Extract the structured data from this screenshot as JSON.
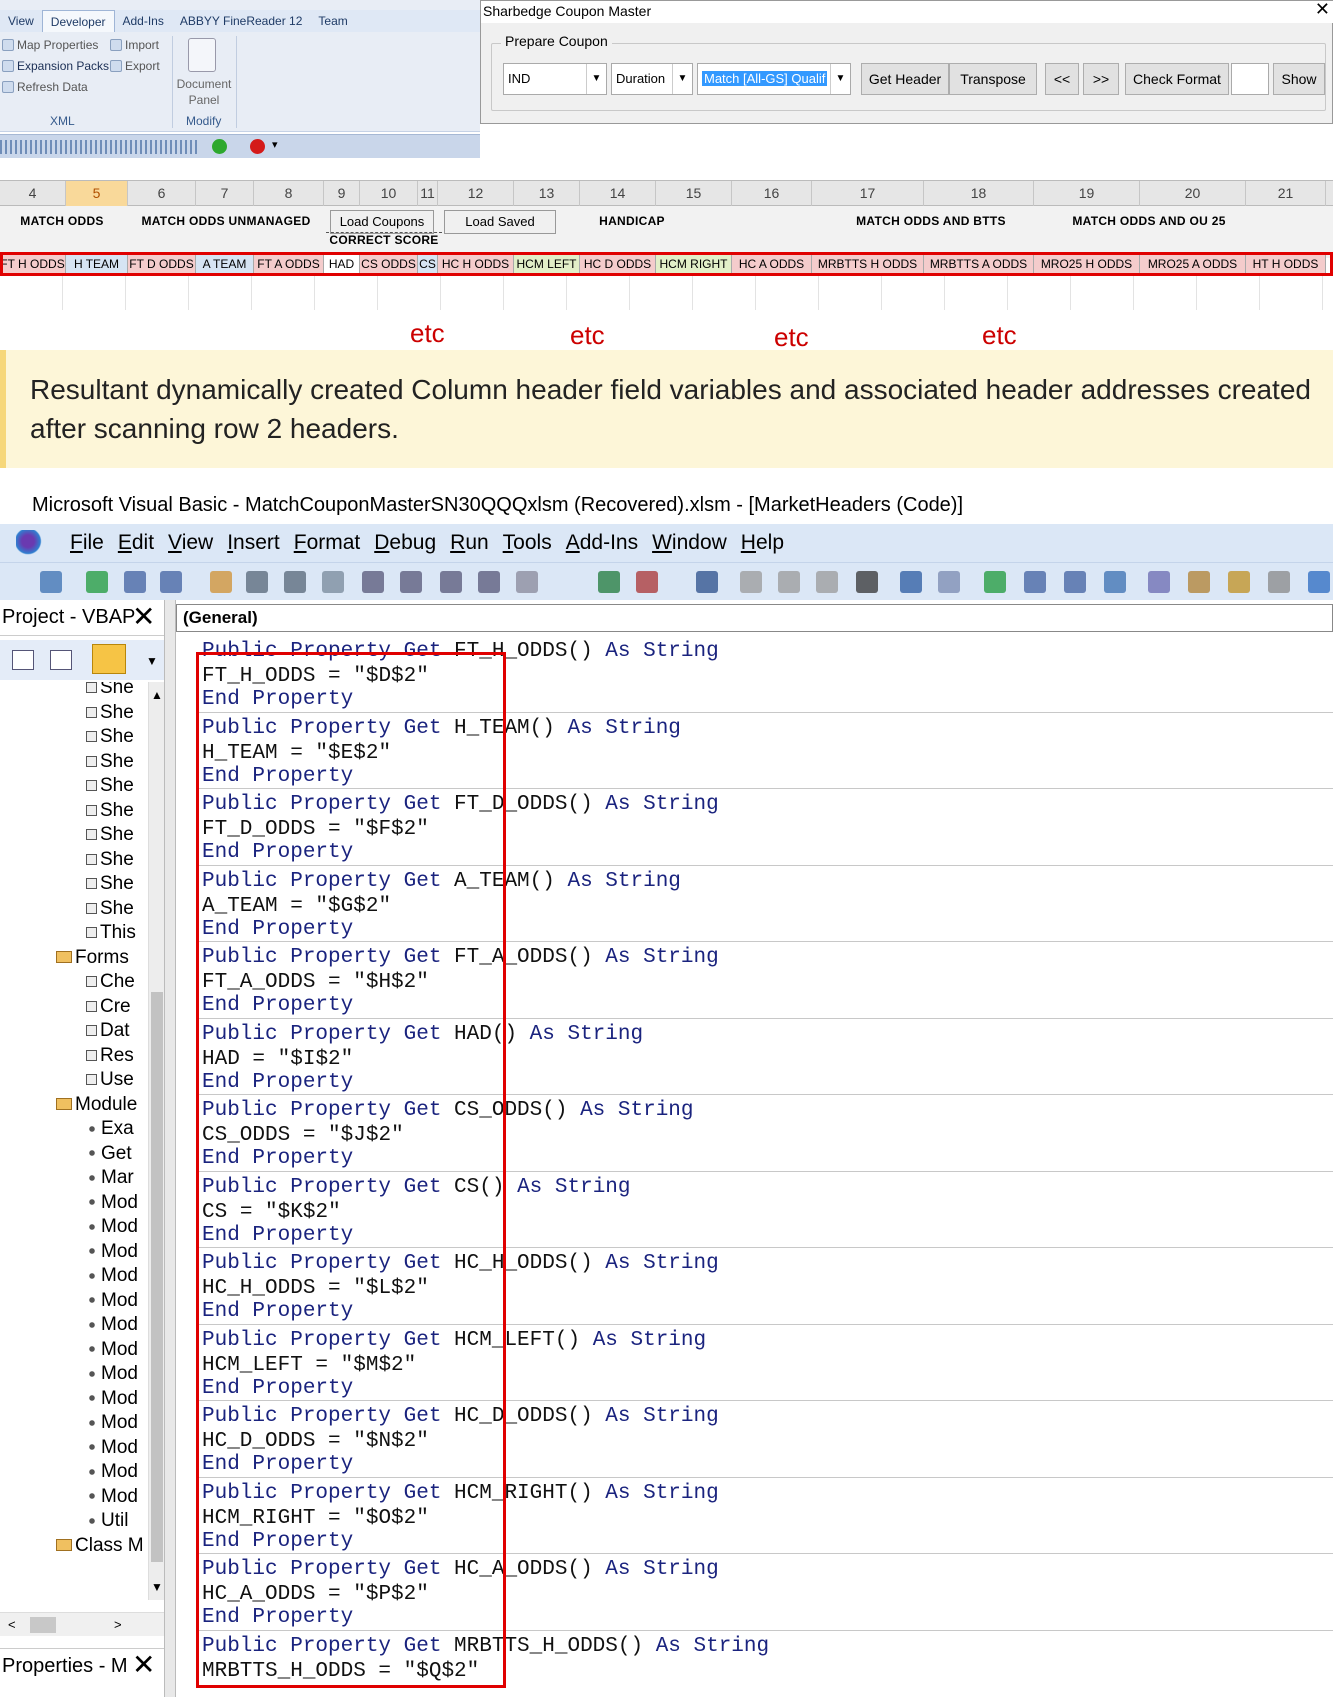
{
  "ribbon": {
    "tabs": [
      "View",
      "Developer",
      "Add-Ins",
      "ABBYY FineReader 12",
      "Team"
    ],
    "active_tab": "Developer",
    "xml": {
      "map_properties": "Map Properties",
      "expansion_packs": "Expansion Packs",
      "refresh_data": "Refresh Data",
      "import": "Import",
      "export": "Export",
      "group_label": "XML"
    },
    "modify": {
      "document_panel_line1": "Document",
      "document_panel_line2": "Panel",
      "group_label": "Modify"
    }
  },
  "coupon": {
    "title": "Sharbedge Coupon Master",
    "close": "✕",
    "group_label": "Prepare Coupon",
    "combo_region": "IND",
    "combo_duration": "Duration",
    "combo_match": "Match [All-GS] Qualif",
    "buttons": {
      "get_header": "Get Header",
      "transpose": "Transpose",
      "prev": "<<",
      "next": ">>",
      "check_format": "Check Format",
      "show": "Show"
    }
  },
  "sheet": {
    "columns": [
      "4",
      "5",
      "6",
      "7",
      "8",
      "9",
      "10",
      "11",
      "12",
      "13",
      "14",
      "15",
      "16",
      "17",
      "18",
      "19",
      "20",
      "21"
    ],
    "load_coupons": "Load Coupons",
    "load_saved": "Load Saved",
    "groups": {
      "match_odds": "MATCH  ODDS",
      "match_odds_unmanaged": "MATCH  ODDS  UNMANAGED",
      "correct_score": "CORRECT  SCORE",
      "handicap": "HANDICAP",
      "match_odds_btts": "MATCH  ODDS  AND  BTTS",
      "match_odds_ou25": "MATCH  ODDS  AND  OU  25"
    },
    "headers": [
      "FT H ODDS",
      "H TEAM",
      "FT D ODDS",
      "A TEAM",
      "FT A ODDS",
      "HAD",
      "CS ODDS",
      "CS",
      "HC H ODDS",
      "HCM LEFT",
      "HC D ODDS",
      "HCM RIGHT",
      "HC A ODDS",
      "MRBTTS H ODDS",
      "MRBTTS A ODDS",
      "MRO25 H ODDS",
      "MRO25 A ODDS",
      "HT H ODDS"
    ],
    "etc": "etc"
  },
  "note": "Resultant dynamically created Column header field variables and associated header addresses created after scanning row 2 headers.",
  "vbe": {
    "title": "Microsoft Visual Basic - MatchCouponMasterSN30QQQxlsm (Recovered).xlsm - [MarketHeaders (Code)]",
    "menu": [
      "File",
      "Edit",
      "View",
      "Insert",
      "Format",
      "Debug",
      "Run",
      "Tools",
      "Add-Ins",
      "Window",
      "Help"
    ],
    "project_title": "Project - VBAP",
    "properties_title": "Properties - M",
    "code_combo": "(General)",
    "tree": {
      "sheets": [
        "She",
        "She",
        "She",
        "She",
        "She",
        "She",
        "She",
        "She",
        "She",
        "She",
        "This"
      ],
      "forms_label": "Forms",
      "forms": [
        "Che",
        "Cre",
        "Dat",
        "Res",
        "Use"
      ],
      "modules_label": "Module",
      "modules": [
        "Exa",
        "Get",
        "Mar",
        "Mod",
        "Mod",
        "Mod",
        "Mod",
        "Mod",
        "Mod",
        "Mod",
        "Mod",
        "Mod",
        "Mod",
        "Mod",
        "Mod",
        "Mod",
        "Util"
      ],
      "class_label": "Class M"
    },
    "code": [
      {
        "name": "FT_H_ODDS",
        "addr": "$D$2"
      },
      {
        "name": "H_TEAM",
        "addr": "$E$2"
      },
      {
        "name": "FT_D_ODDS",
        "addr": "$F$2"
      },
      {
        "name": "A_TEAM",
        "addr": "$G$2"
      },
      {
        "name": "FT_A_ODDS",
        "addr": "$H$2"
      },
      {
        "name": "HAD",
        "addr": "$I$2"
      },
      {
        "name": "CS_ODDS",
        "addr": "$J$2"
      },
      {
        "name": "CS",
        "addr": "$K$2"
      },
      {
        "name": "HC_H_ODDS",
        "addr": "$L$2"
      },
      {
        "name": "HCM_LEFT",
        "addr": "$M$2"
      },
      {
        "name": "HC_D_ODDS",
        "addr": "$N$2"
      },
      {
        "name": "HCM_RIGHT",
        "addr": "$O$2"
      },
      {
        "name": "HC_A_ODDS",
        "addr": "$P$2"
      },
      {
        "name": "MRBTTS_H_ODDS",
        "addr": "$Q$2"
      }
    ]
  }
}
